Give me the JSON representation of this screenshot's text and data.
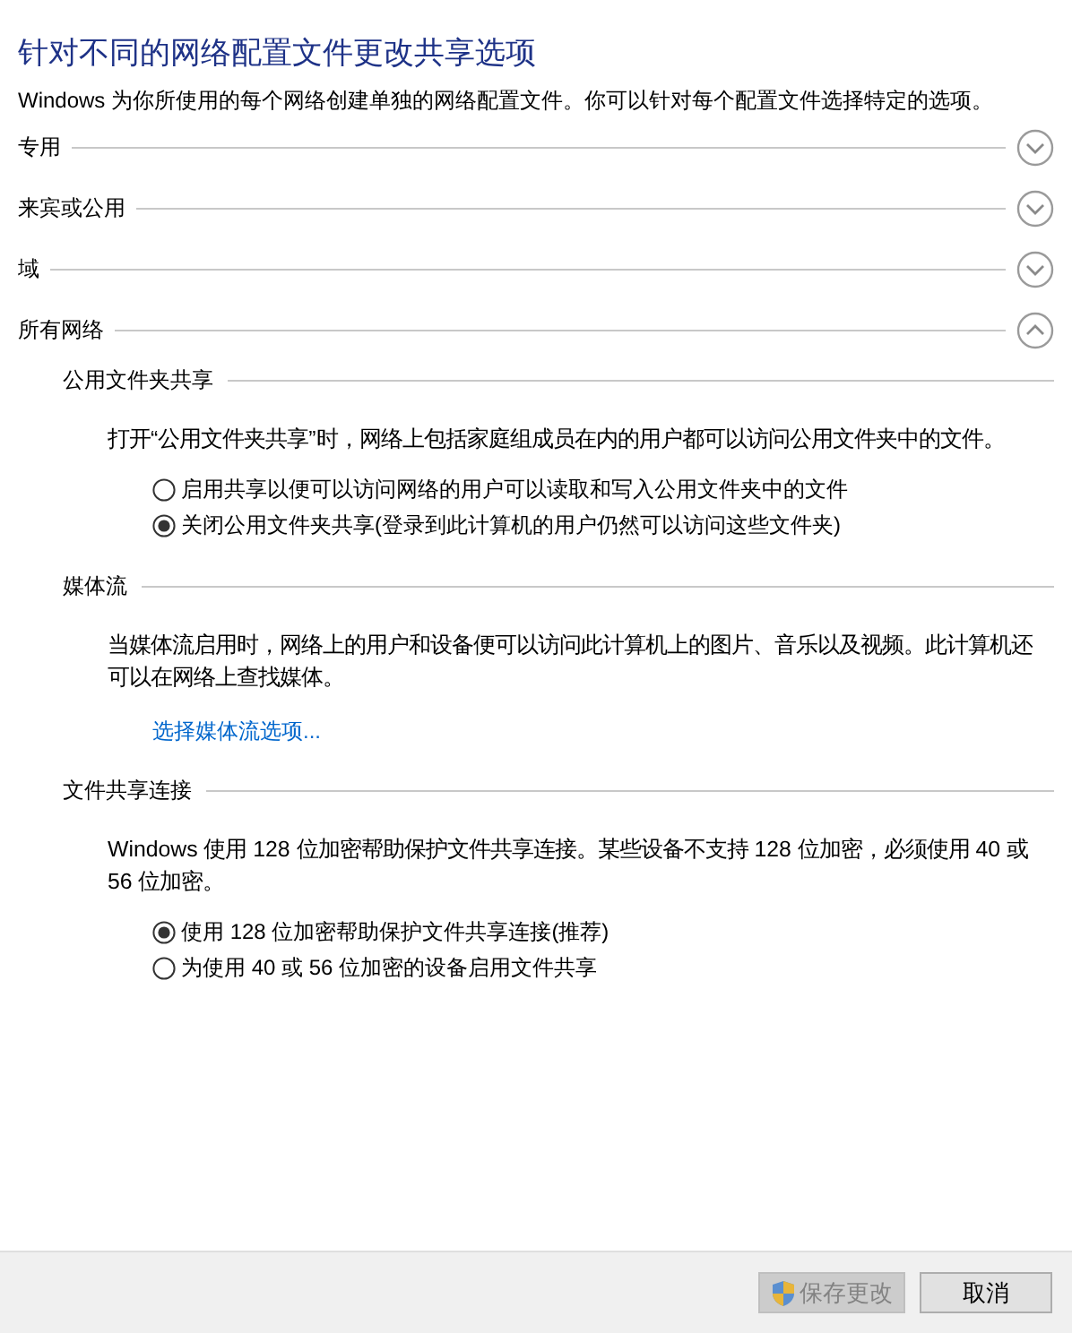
{
  "title": "针对不同的网络配置文件更改共享选项",
  "description": "Windows 为你所使用的每个网络创建单独的网络配置文件。你可以针对每个配置文件选择特定的选项。",
  "profiles": [
    {
      "label": "专用",
      "expanded": false
    },
    {
      "label": "来宾或公用",
      "expanded": false
    },
    {
      "label": "域",
      "expanded": false
    },
    {
      "label": "所有网络",
      "expanded": true,
      "sections": [
        {
          "heading": "公用文件夹共享",
          "description": "打开“公用文件夹共享”时，网络上包括家庭组成员在内的用户都可以访问公用文件夹中的文件。",
          "options": [
            {
              "label": "启用共享以便可以访问网络的用户可以读取和写入公用文件夹中的文件",
              "selected": false
            },
            {
              "label": "关闭公用文件夹共享(登录到此计算机的用户仍然可以访问这些文件夹)",
              "selected": true
            }
          ]
        },
        {
          "heading": "媒体流",
          "description": "当媒体流启用时，网络上的用户和设备便可以访问此计算机上的图片、音乐以及视频。此计算机还可以在网络上查找媒体。",
          "link": "选择媒体流选项..."
        },
        {
          "heading": "文件共享连接",
          "description": "Windows 使用 128 位加密帮助保护文件共享连接。某些设备不支持 128 位加密，必须使用 40 或 56 位加密。",
          "options": [
            {
              "label": "使用 128 位加密帮助保护文件共享连接(推荐)",
              "selected": true
            },
            {
              "label": "为使用 40 或 56 位加密的设备启用文件共享",
              "selected": false
            }
          ]
        }
      ]
    }
  ],
  "buttons": [
    {
      "label": "保存更改",
      "disabled": true,
      "kind": "shield"
    },
    {
      "label": "取消",
      "disabled": false,
      "kind": "plain"
    }
  ]
}
